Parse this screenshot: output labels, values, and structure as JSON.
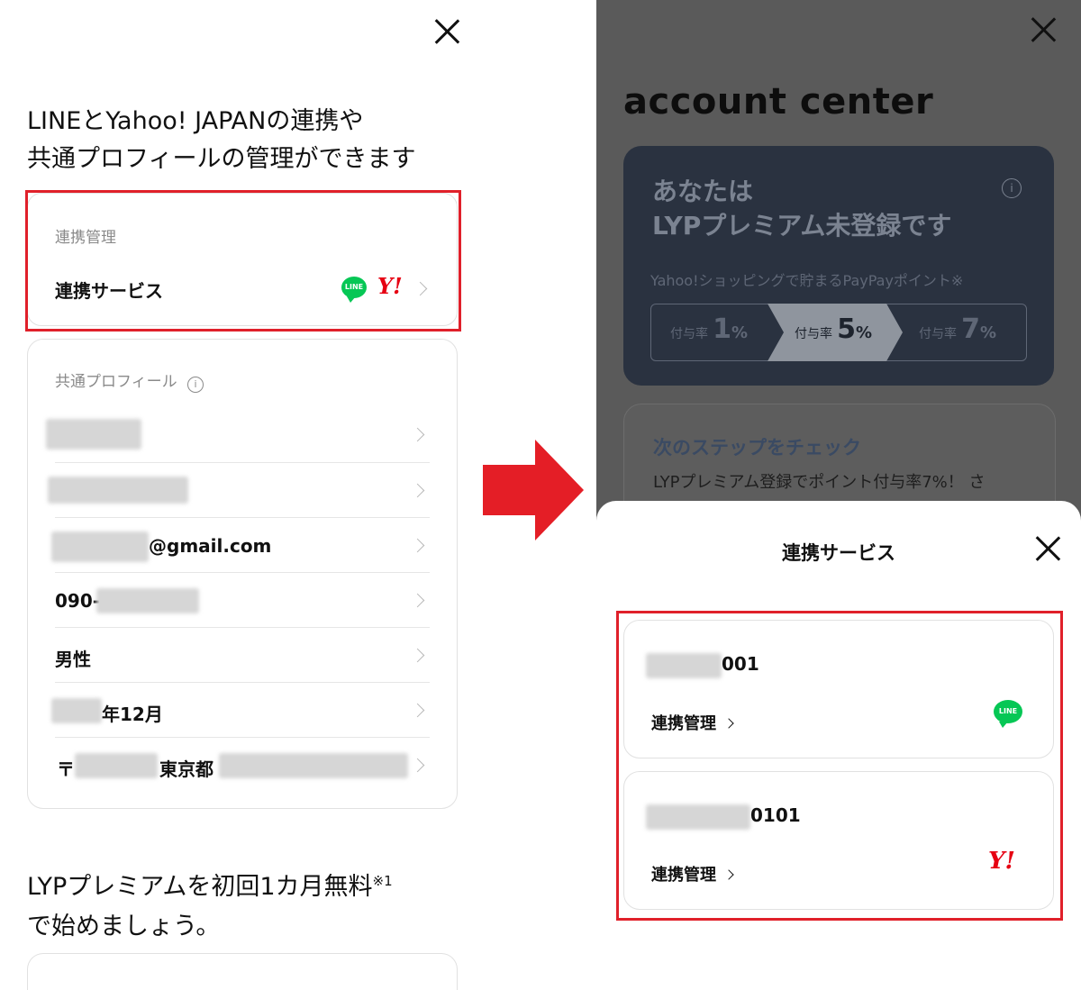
{
  "left": {
    "heading_line1": "LINEとYahoo! JAPANの連携や",
    "heading_line2": "共通プロフィールの管理ができます",
    "link_section": {
      "label": "連携管理",
      "row_label": "連携サービス",
      "line_logo": "LINE",
      "yahoo_logo": "Y!"
    },
    "profile": {
      "label": "共通プロフィール",
      "email_suffix": "@gmail.com",
      "phone_prefix": "090-",
      "gender": "男性",
      "birth_suffix": "年12月",
      "postal_mark": "〒",
      "prefecture": "東京都"
    },
    "promo_line1": "LYPプレミアムを初回1カ月無料",
    "promo_sup": "※1",
    "promo_line2": "で始めましょう。"
  },
  "right": {
    "title": "account center",
    "premium": {
      "line1": "あなたは",
      "line2": "LYPプレミアム未登録です",
      "sub": "Yahoo!ショッピングで貯まるPayPayポイント※",
      "tiers": [
        {
          "label": "付与率",
          "value": "1",
          "unit": "%"
        },
        {
          "label": "付与率",
          "value": "5",
          "unit": "%"
        },
        {
          "label": "付与率",
          "value": "7",
          "unit": "%"
        }
      ]
    },
    "steps": {
      "title": "次のステップをチェック",
      "text": "LYPプレミアム登録でポイント付与率7%！ さ"
    },
    "sheet": {
      "title": "連携サービス",
      "accounts": [
        {
          "suffix": "001",
          "manage": "連携管理",
          "logo": "LINE"
        },
        {
          "suffix": "0101",
          "manage": "連携管理",
          "logo": "Y!"
        }
      ]
    }
  }
}
